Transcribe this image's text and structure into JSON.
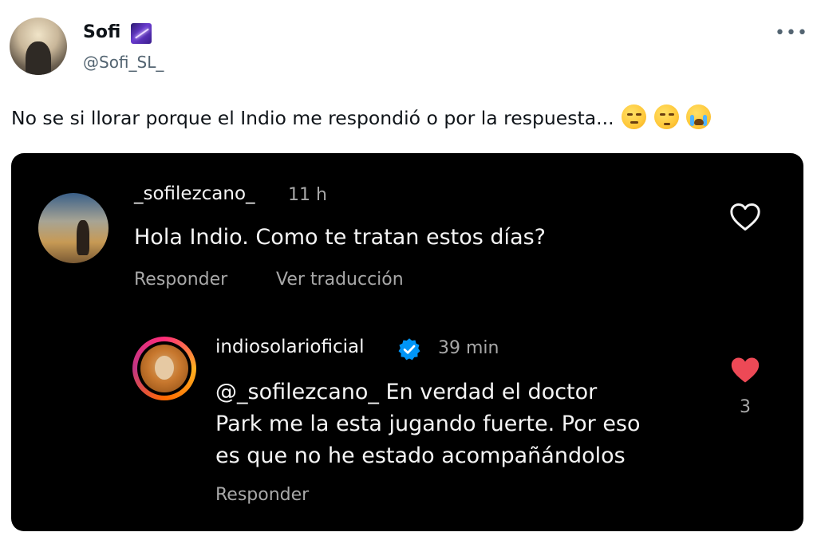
{
  "author": {
    "name": "Sofi",
    "handle": "@Sofi_SL_",
    "badge_icon": "shooting-star-icon"
  },
  "tweet": {
    "text": "No se si llorar porque el Indio me respondió o por la respuesta...",
    "emojis": [
      "relieved-face-icon",
      "disappointed-face-icon",
      "loudly-crying-face-icon"
    ]
  },
  "embedded_screenshot": {
    "comment": {
      "username": "_sofilezcano_",
      "time": "11 h",
      "text": "Hola Indio. Como te tratan estos días?",
      "reply_label": "Responder",
      "translate_label": "Ver traducción",
      "liked": false
    },
    "reply": {
      "username": "indiosolarioficial",
      "verified": true,
      "time": "39 min",
      "text_lines": [
        "@_sofilezcano_ En verdad el doctor",
        "Park me la esta jugando fuerte. Por eso",
        "es que  no he estado acompañándolos"
      ],
      "reply_label": "Responder",
      "liked": true,
      "like_count": "3"
    }
  },
  "colors": {
    "background": "#ffffff",
    "embedded_background": "#000000",
    "heart_red": "#ed4956",
    "verified_blue": "#0095f6",
    "secondary_text": "#a8a8a8"
  }
}
